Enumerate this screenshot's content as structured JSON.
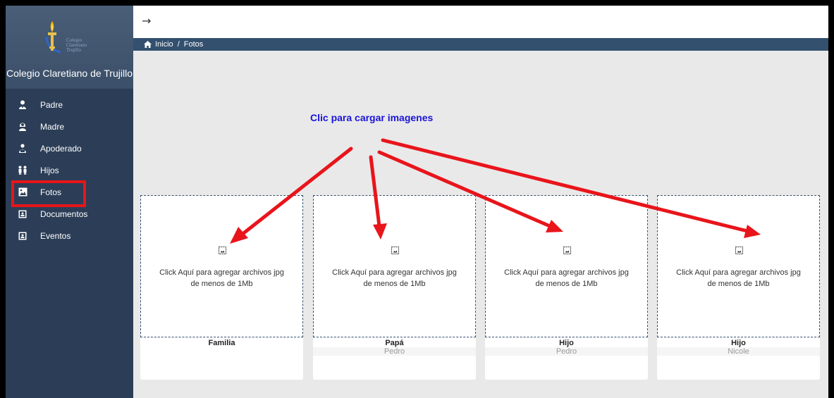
{
  "app": {
    "school_name": "Colegio Claretiano de Trujillo",
    "logo_text": "Colegio Claretiano Trujillo"
  },
  "sidebar": {
    "items": [
      {
        "label": "Padre",
        "icon": "father-icon"
      },
      {
        "label": "Madre",
        "icon": "mother-icon"
      },
      {
        "label": "Apoderado",
        "icon": "guardian-icon"
      },
      {
        "label": "Hijos",
        "icon": "children-icon"
      },
      {
        "label": "Fotos",
        "icon": "photo-icon"
      },
      {
        "label": "Documentos",
        "icon": "document-icon"
      },
      {
        "label": "Eventos",
        "icon": "event-icon"
      }
    ]
  },
  "topbar": {
    "back_icon": "arrow-right-icon"
  },
  "breadcrumb": {
    "home": "Inicio",
    "separator": "/",
    "current": "Fotos"
  },
  "annotation": {
    "text": "Clic para cargar imagenes",
    "color": "#1a14d8",
    "arrow_color": "#e8151b"
  },
  "cards": [
    {
      "dropzone_text": "Click Aquí para agregar archivos jpg de menos de 1Mb",
      "label": "Familia",
      "sub": ""
    },
    {
      "dropzone_text": "Click Aquí para agregar archivos jpg de menos de 1Mb",
      "label": "Papá",
      "sub": "Pedro"
    },
    {
      "dropzone_text": "Click Aquí para agregar archivos jpg de menos de 1Mb",
      "label": "Hijo",
      "sub": "Pedro"
    },
    {
      "dropzone_text": "Click Aquí para agregar archivos jpg de menos de 1Mb",
      "label": "Hijo",
      "sub": "Nicole"
    }
  ],
  "colors": {
    "sidebar_bg": "#2c3e57",
    "breadcrumb_bg": "#34506f",
    "content_bg": "#e9e9e9",
    "highlight": "#e8151b"
  }
}
